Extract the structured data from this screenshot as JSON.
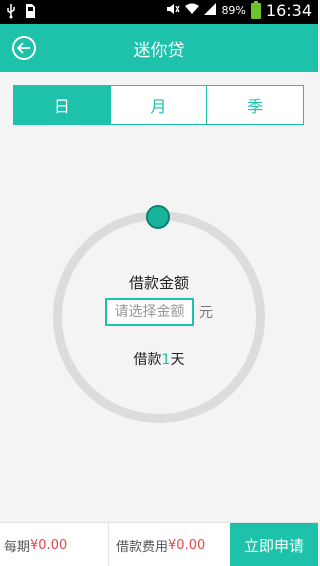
{
  "status": {
    "battery": "89%",
    "time": "16:34"
  },
  "header": {
    "title": "迷你贷"
  },
  "tabs": [
    {
      "label": "日"
    },
    {
      "label": "月"
    },
    {
      "label": "季"
    }
  ],
  "loan": {
    "amount_label": "借款金额",
    "amount_placeholder": "请选择金额",
    "unit": "元",
    "days_prefix": "借款",
    "days_value": "1",
    "days_suffix": "天"
  },
  "footer": {
    "period_label": "每期",
    "period_value": "¥0.00",
    "fee_label": "借款费用",
    "fee_value": "¥0.00",
    "apply_label": "立即申请"
  },
  "colors": {
    "accent": "#1ec1aa",
    "price": "#e2474a"
  }
}
